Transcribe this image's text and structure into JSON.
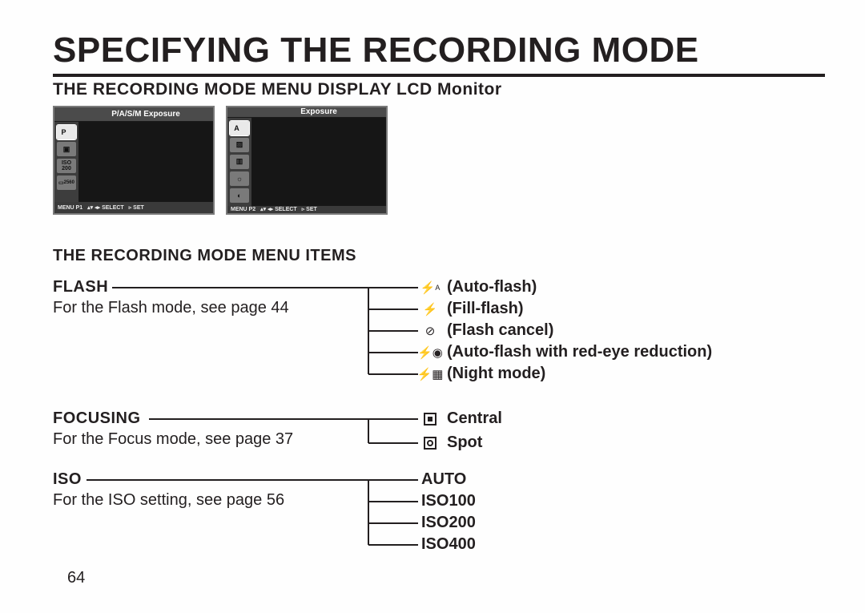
{
  "page": {
    "title": "SPECIFYING THE RECORDING MODE",
    "section1_header": "THE RECORDING MODE MENU DISPLAY LCD Monitor",
    "section2_header": "THE RECORDING MODE MENU ITEMS",
    "page_number": "64"
  },
  "lcd": {
    "panel1": {
      "title": "P/A/S/M Exposure",
      "side": {
        "p": "P",
        "iso": "ISO",
        "iso_val": "200",
        "size": "2560"
      },
      "footer": {
        "menu": "MENU P1",
        "select": "SELECT",
        "set": "SET"
      }
    },
    "panel2": {
      "title": "Exposure",
      "side": {
        "a": "A"
      },
      "footer": {
        "menu": "MENU P2",
        "select": "SELECT",
        "set": "SET"
      }
    }
  },
  "items": {
    "flash": {
      "label": "FLASH",
      "desc": "For the Flash mode, see page 44",
      "options": {
        "auto": "Auto-flash",
        "fill": "Fill-flash",
        "cancel": "Flash cancel",
        "redeye": "Auto-flash with red-eye reduction",
        "night": "Night mode"
      }
    },
    "focusing": {
      "label": "FOCUSING",
      "desc": "For the Focus mode, see page 37",
      "options": {
        "central": "Central",
        "spot": "Spot"
      }
    },
    "iso": {
      "label": "ISO",
      "desc": "For the ISO setting, see page 56",
      "options": {
        "auto": "AUTO",
        "iso100": "ISO100",
        "iso200": "ISO200",
        "iso400": "ISO400"
      }
    }
  }
}
